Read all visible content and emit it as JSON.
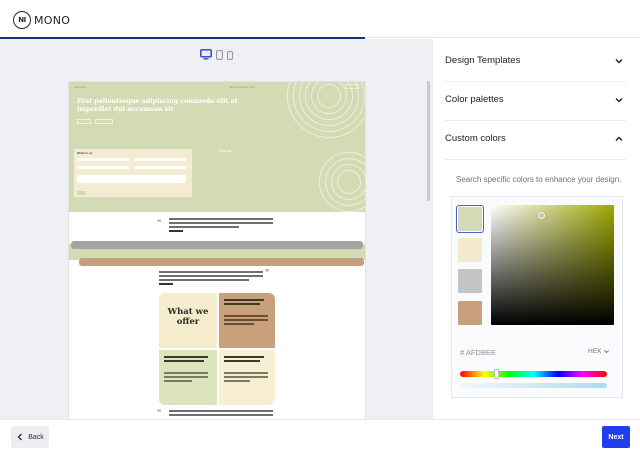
{
  "brand": {
    "mark": "NI",
    "name": "MONO"
  },
  "progress_percent": 57,
  "preview": {
    "hero_nav_label": "sitename",
    "hero_navlinks": "Item  Item  Item  Item",
    "hero_title": "Erat pellentesque adipiscing commodo elit at imperdiet dui accumsan sit",
    "form_title": "Write to us",
    "hero_side_label": "Ipsum",
    "card_big_text": "What we offer"
  },
  "sidebar": {
    "sections": [
      {
        "label": "Design Templates",
        "expanded": false
      },
      {
        "label": "Color palettes",
        "expanded": false
      },
      {
        "label": "Custom colors",
        "expanded": true
      }
    ],
    "hint": "Search specific colors to enhance your design.",
    "swatches": [
      {
        "color": "#d3dbb4",
        "selected": true
      },
      {
        "color": "#f5ead0",
        "selected": false
      },
      {
        "color": "#c4c4c4",
        "selected": false
      },
      {
        "color": "#c9a07c",
        "selected": false
      }
    ],
    "hex_value": "# AFDBEE",
    "hex_mode": "HEX"
  },
  "footer": {
    "back_label": "Back",
    "next_label": "Next"
  }
}
